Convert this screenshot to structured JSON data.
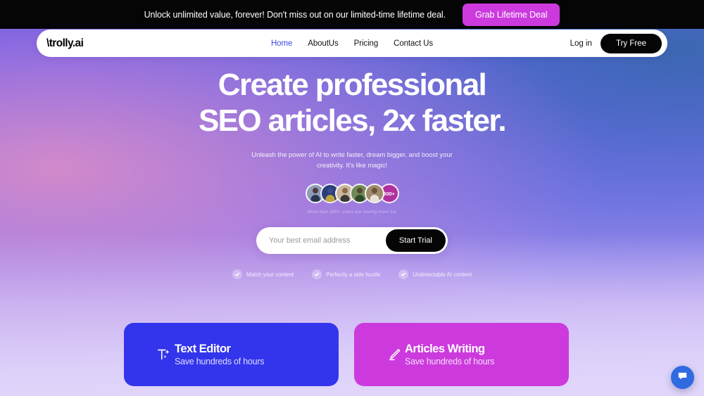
{
  "announcement": {
    "text": "Unlock unlimited value, forever! Don't miss out on our limited-time lifetime deal.",
    "cta_label": "Grab Lifetime Deal",
    "cta_color": "#cc3ade",
    "bar_color": "#050505"
  },
  "nav": {
    "logo": "\\trolly.ai",
    "links": [
      {
        "label": "Home",
        "active": true
      },
      {
        "label": "AboutUs",
        "active": false
      },
      {
        "label": "Pricing",
        "active": false
      },
      {
        "label": "Contact Us",
        "active": false
      }
    ],
    "login_label": "Log in",
    "try_free_label": "Try Free",
    "active_color": "#3b49e8"
  },
  "hero": {
    "headline_line1": "Create professional",
    "headline_line2": "SEO articles, 2x faster.",
    "subtitle": "Unleash the power of AI to write faster, dream bigger, and boost your creativity. It's like magic!",
    "users_caption": "More than 300+ users are having more fun",
    "avatar_badge": "300+",
    "avatar_badge_color": "#b0309f",
    "avatars": [
      {
        "name": "user-avatar-1",
        "bg": "#8f9bb8",
        "head": "#4a3b33",
        "body": "#2b3550"
      },
      {
        "name": "user-avatar-2",
        "bg": "#2a3f7a",
        "head": "#3a4d86",
        "body": "#c2a23a"
      },
      {
        "name": "user-avatar-3",
        "bg": "#cbb79c",
        "head": "#8a6a4a",
        "body": "#3a3a3a"
      },
      {
        "name": "user-avatar-4",
        "bg": "#6f8a55",
        "head": "#5c4633",
        "body": "#2e4a2a"
      },
      {
        "name": "user-avatar-5",
        "bg": "#a08a6d",
        "head": "#6d5138",
        "body": "#e8e2d8"
      }
    ],
    "email_placeholder": "Your best email address",
    "email_value": "",
    "start_trial_label": "Start Trial",
    "checks": [
      {
        "label": "Match your content"
      },
      {
        "label": "Perfectly a side hustle"
      },
      {
        "label": "Undetectable AI content"
      }
    ]
  },
  "cards": [
    {
      "title": "Text Editor",
      "subtitle": "Save hundreds of hours",
      "color": "#3335ec",
      "icon": "text-sparkle-icon"
    },
    {
      "title": "Articles Writing",
      "subtitle": "Save hundreds of hours",
      "color": "#cc3ade",
      "icon": "pencil-icon"
    }
  ],
  "chat": {
    "icon": "chat-bubble-icon",
    "color": "#2f6ae0"
  }
}
